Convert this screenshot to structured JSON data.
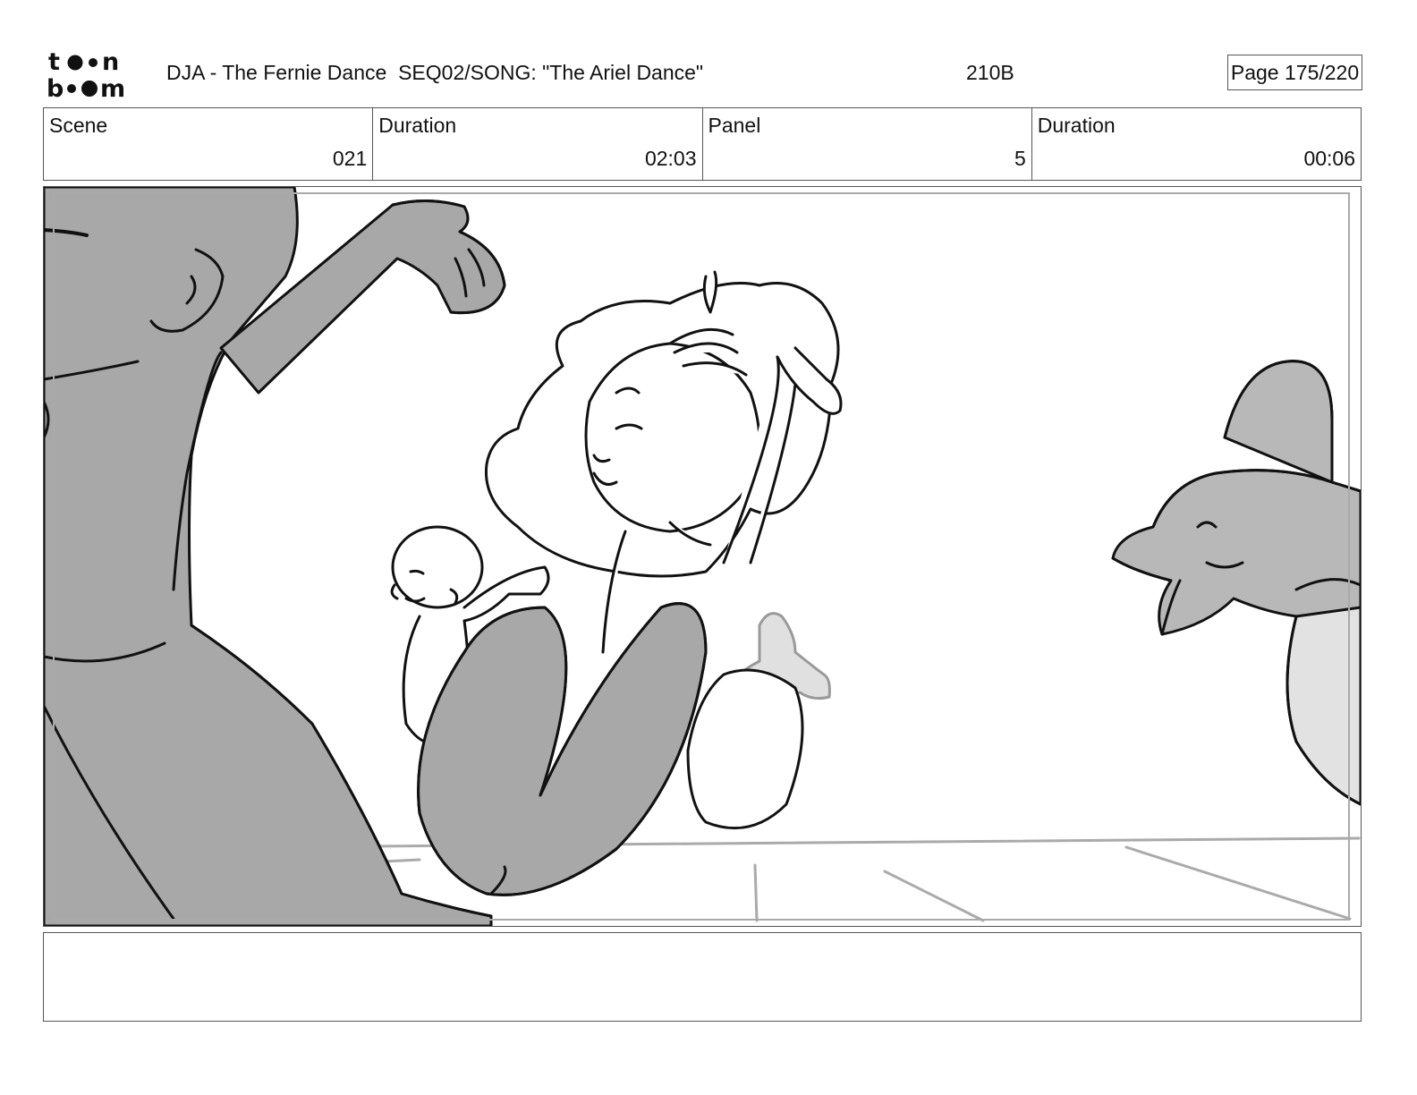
{
  "header": {
    "logo_text": "toon boom",
    "title": "DJA - The Fernie Dance  SEQ02/SONG: \"The Ariel Dance\"",
    "panel_code": "210B",
    "page": "Page 175/220"
  },
  "info": {
    "scene_label": "Scene",
    "scene_value": "021",
    "duration_label": "Duration",
    "duration_value": "02:03",
    "panel_label": "Panel",
    "panel_value": "5",
    "panel_duration_label": "Duration",
    "panel_duration_value": "00:06"
  },
  "notes": {
    "text": ""
  }
}
